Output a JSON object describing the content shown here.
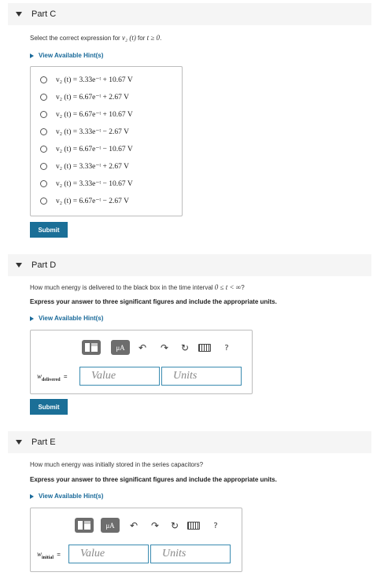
{
  "partC": {
    "title": "Part C",
    "prompt_pre": "Select the correct expression for ",
    "prompt_var": "v₂ (t)",
    "prompt_mid": " for ",
    "prompt_cond": "t ≥ 0",
    "prompt_end": ".",
    "hint": "View Available Hint(s)",
    "choices": [
      "v₂ (t) = 3.33e⁻ᵗ + 10.67 V",
      "v₂ (t) = 6.67e⁻ᵗ + 2.67 V",
      "v₂ (t) = 6.67e⁻ᵗ + 10.67 V",
      "v₂ (t) = 3.33e⁻ᵗ − 2.67 V",
      "v₂ (t) = 6.67e⁻ᵗ − 10.67 V",
      "v₂ (t) = 3.33e⁻ᵗ + 2.67 V",
      "v₂ (t) = 3.33e⁻ᵗ − 10.67 V",
      "v₂ (t) = 6.67e⁻ᵗ − 2.67 V"
    ],
    "submit": "Submit"
  },
  "partD": {
    "title": "Part D",
    "question_pre": "How much energy is delivered to the black box in the time interval ",
    "question_math": "0 ≤ t < ∞",
    "question_end": "?",
    "instruction": "Express your answer to three significant figures and include the appropriate units.",
    "hint": "View Available Hint(s)",
    "var_main": "w",
    "var_sub": "delivered",
    "equals": "=",
    "value_placeholder": "Value",
    "units_placeholder": "Units",
    "mu_label": "μA",
    "help": "?",
    "submit": "Submit"
  },
  "partE": {
    "title": "Part E",
    "question": "How much energy was initially stored in the series capacitors?",
    "instruction": "Express your answer to three significant figures and include the appropriate units.",
    "hint": "View Available Hint(s)",
    "var_main": "w",
    "var_sub": "initial",
    "equals": "=",
    "value_placeholder": "Value",
    "units_placeholder": "Units",
    "mu_label": "μA",
    "help": "?"
  },
  "icons": {
    "collapse": "triangle-down-icon",
    "hint_arrow": "triangle-right-icon",
    "undo": "undo-icon",
    "redo": "redo-icon",
    "reset": "reset-icon",
    "keyboard": "keyboard-icon"
  },
  "colors": {
    "accent": "#1b6f97",
    "link": "#1a6a9a",
    "field_border": "#3a8bb0",
    "header_bg": "#f5f5f5"
  }
}
